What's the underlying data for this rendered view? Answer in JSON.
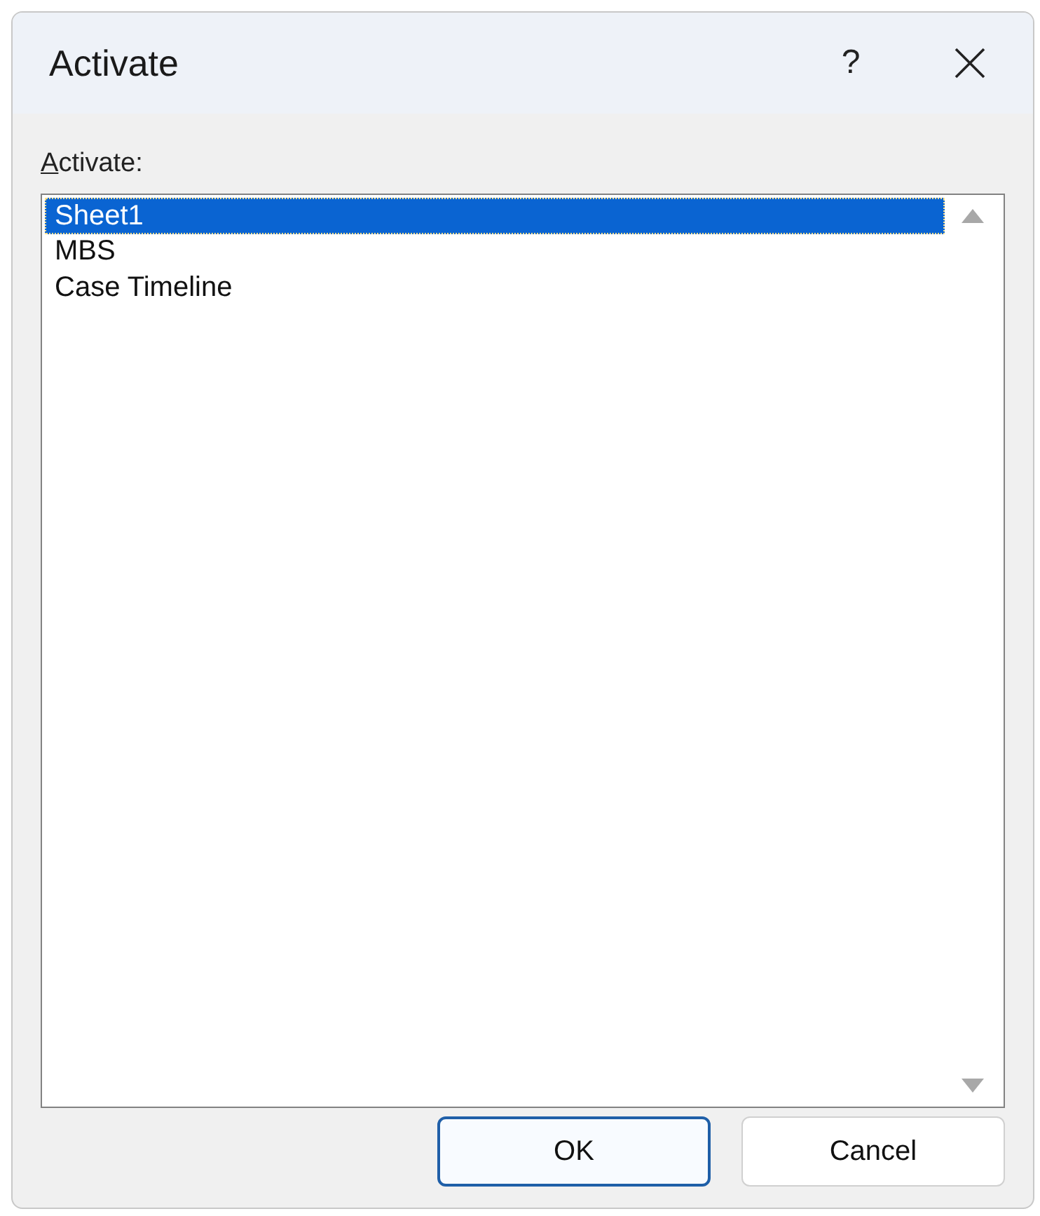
{
  "window": {
    "title": "Activate",
    "help": "?"
  },
  "list_label": {
    "text": "Activate:",
    "mnemonic": true
  },
  "sheets": [
    {
      "label": "Sheet1",
      "selected": true
    },
    {
      "label": "MBS",
      "selected": false
    },
    {
      "label": "Case Timeline",
      "selected": false
    }
  ],
  "buttons": [
    {
      "label": "OK",
      "default": true
    },
    {
      "label": "Cancel",
      "default": false
    }
  ]
}
